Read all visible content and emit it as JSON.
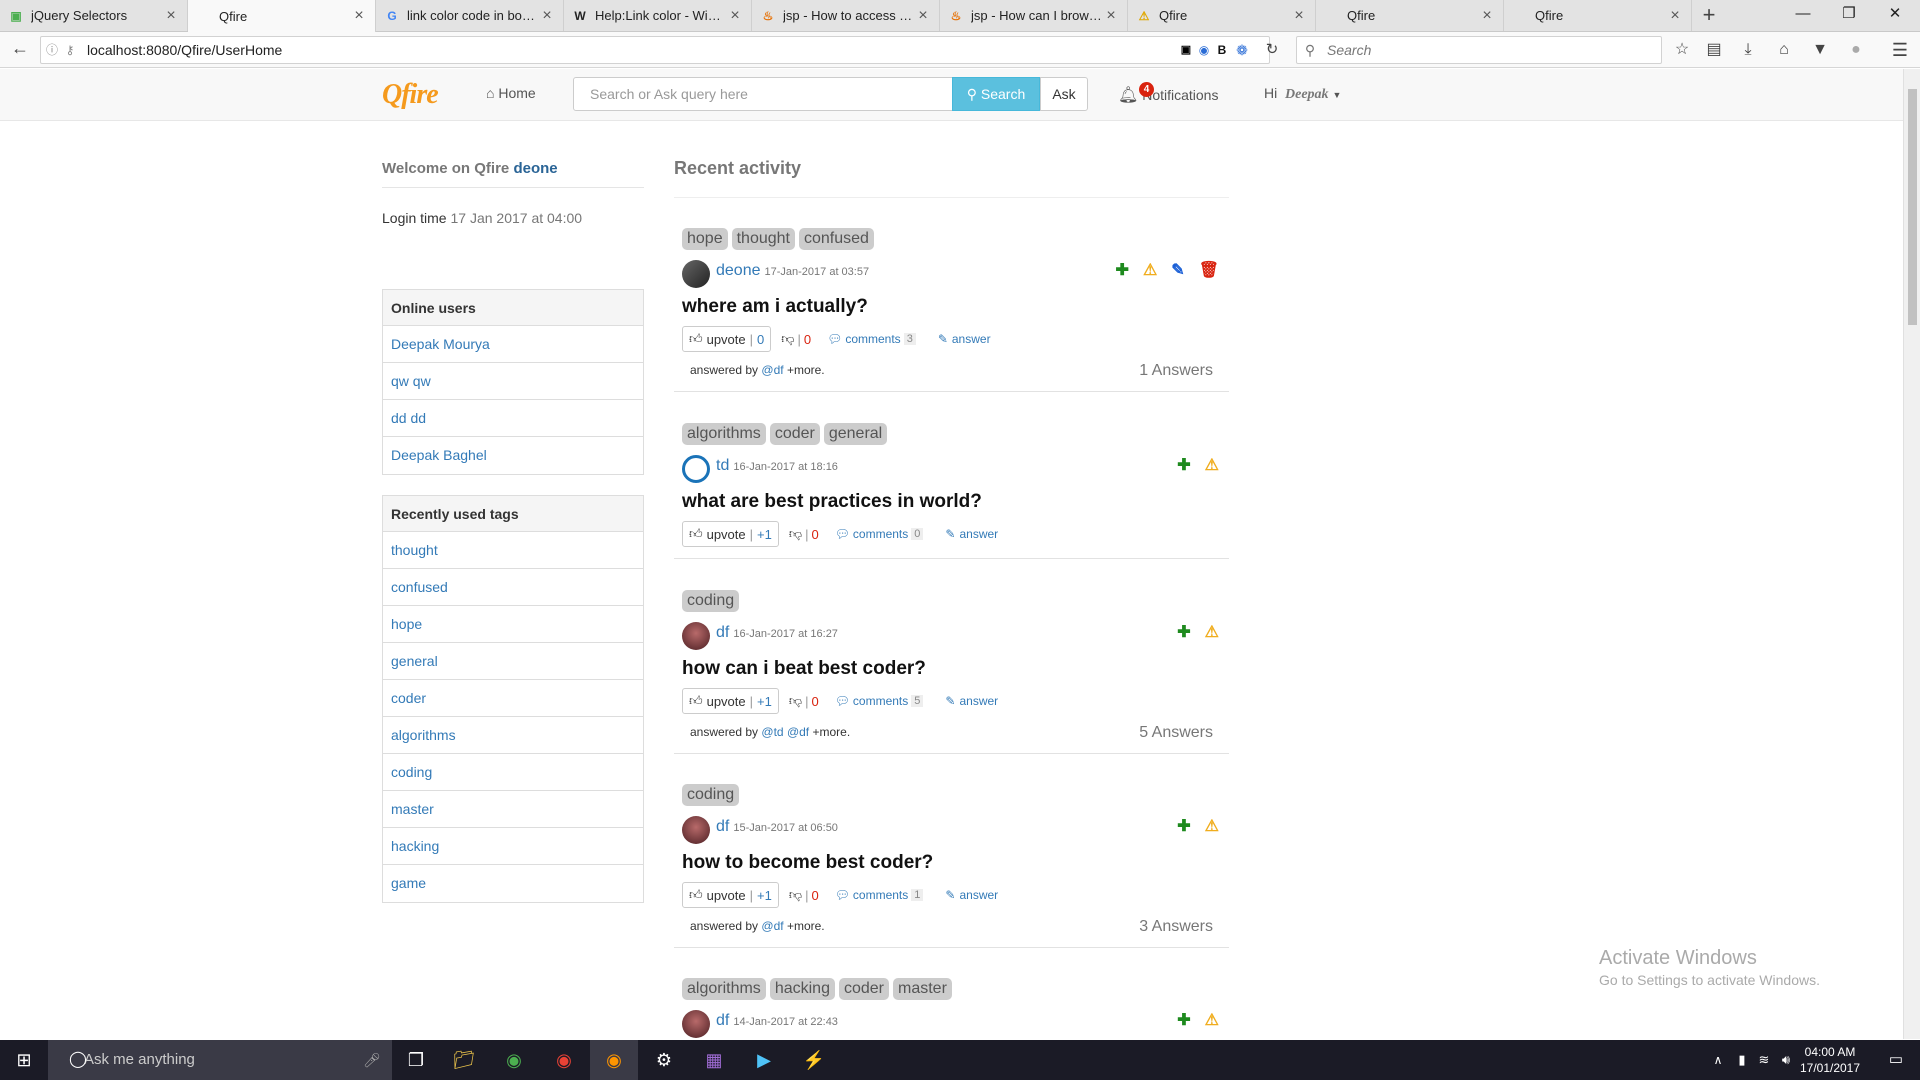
{
  "browser": {
    "tabs": [
      {
        "title": "jQuery Selectors",
        "favicon": "w3-icon",
        "active": false
      },
      {
        "title": "Qfire",
        "favicon": "blank-icon",
        "active": true
      },
      {
        "title": "link color code in boo...",
        "favicon": "google-icon",
        "active": false
      },
      {
        "title": "Help:Link color - Wiki...",
        "favicon": "wikipedia-icon",
        "active": false
      },
      {
        "title": "jsp - How to access T...",
        "favicon": "java-icon",
        "active": false
      },
      {
        "title": "jsp - How can I brows...",
        "favicon": "java-icon",
        "active": false
      },
      {
        "title": "Qfire",
        "favicon": "warning-icon",
        "active": false
      },
      {
        "title": "Qfire",
        "favicon": "blank-icon",
        "active": false
      },
      {
        "title": "Qfire",
        "favicon": "blank-icon",
        "active": false
      }
    ],
    "url": "localhost:8080/Qfire/UserHome",
    "search_placeholder": "Search"
  },
  "site": {
    "logo": "Qfire",
    "home_label": "Home",
    "query_placeholder": "Search or Ask query here",
    "search_button": "Search",
    "ask_button": "Ask",
    "notifications_label": "Notifications",
    "notifications_count": "4",
    "greeting": "Hi",
    "username": "Deepak"
  },
  "sidebar": {
    "welcome_text": "Welcome on Qfire",
    "welcome_user": "deone",
    "login_label": "Login time",
    "login_time": "17 Jan 2017 at 04:00",
    "online_users_title": "Online users",
    "online_users": [
      "Deepak Mourya",
      "qw qw",
      "dd dd",
      "Deepak Baghel"
    ],
    "tags_title": "Recently used tags",
    "tags": [
      "thought",
      "confused",
      "hope",
      "general",
      "coder",
      "algorithms",
      "coding",
      "master",
      "hacking",
      "game"
    ]
  },
  "feed": {
    "title": "Recent activity",
    "posts": [
      {
        "tags": [
          "hope",
          "thought",
          "confused"
        ],
        "user": "deone",
        "date": "17-Jan-2017 at 03:57",
        "title": "where am i actually?",
        "upvote_label": "upvote",
        "upvotes": "0",
        "downvotes": "0",
        "comments_label": "comments",
        "comments": "3",
        "answer_label": "answer",
        "answered_by": "answered by",
        "answerers": [
          "@df"
        ],
        "more": "+more.",
        "answers_count": "1 Answers",
        "owner": true
      },
      {
        "tags": [
          "algorithms",
          "coder",
          "general"
        ],
        "user": "td",
        "date": "16-Jan-2017 at 18:16",
        "title": "what are best practices in world?",
        "upvote_label": "upvote",
        "upvotes": "+1",
        "downvotes": "0",
        "comments_label": "comments",
        "comments": "0",
        "answer_label": "answer",
        "owner": false
      },
      {
        "tags": [
          "coding"
        ],
        "user": "df",
        "date": "16-Jan-2017 at 16:27",
        "title": "how can i beat best coder?",
        "upvote_label": "upvote",
        "upvotes": "+1",
        "downvotes": "0",
        "comments_label": "comments",
        "comments": "5",
        "answer_label": "answer",
        "answered_by": "answered by",
        "answerers": [
          "@td",
          "@df"
        ],
        "more": "+more.",
        "answers_count": "5 Answers",
        "owner": false
      },
      {
        "tags": [
          "coding"
        ],
        "user": "df",
        "date": "15-Jan-2017 at 06:50",
        "title": "how to become best coder?",
        "upvote_label": "upvote",
        "upvotes": "+1",
        "downvotes": "0",
        "comments_label": "comments",
        "comments": "1",
        "answer_label": "answer",
        "answered_by": "answered by",
        "answerers": [
          "@df"
        ],
        "more": "+more.",
        "answers_count": "3 Answers",
        "owner": false
      },
      {
        "tags": [
          "algorithms",
          "hacking",
          "coder",
          "master"
        ],
        "user": "df",
        "date": "14-Jan-2017 at 22:43",
        "owner": false
      }
    ]
  },
  "watermark": {
    "line1": "Activate Windows",
    "line2": "Go to Settings to activate Windows."
  },
  "taskbar": {
    "search_placeholder": "Ask me anything",
    "time": "04:00 AM",
    "date": "17/01/2017"
  },
  "colors": {
    "link": "#337ab7",
    "search_button": "#5bc0de",
    "logo": "#f59a1d",
    "badge": "#d9230f",
    "plus_icon": "#1e8a1e",
    "warning_icon": "#f0ad1e",
    "delete_icon": "#d9230f"
  }
}
